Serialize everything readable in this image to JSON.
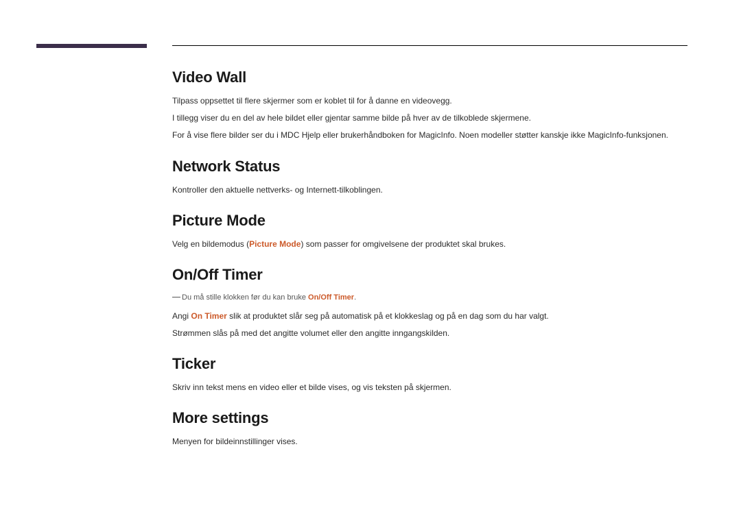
{
  "sections": {
    "video_wall": {
      "title": "Video Wall",
      "p1": "Tilpass oppsettet til flere skjermer som er koblet til for å danne en videovegg.",
      "p2": "I tillegg viser du en del av hele bildet eller gjentar samme bilde på hver av de tilkoblede skjermene.",
      "p3": "For å vise flere bilder ser du i MDC Hjelp eller brukerhåndboken for MagicInfo. Noen modeller støtter kanskje ikke MagicInfo-funksjonen."
    },
    "network_status": {
      "title": "Network Status",
      "p1": "Kontroller den aktuelle nettverks- og Internett-tilkoblingen."
    },
    "picture_mode": {
      "title": "Picture Mode",
      "p1_a": "Velg en bildemodus (",
      "p1_hl": "Picture Mode",
      "p1_b": ") som passer for omgivelsene der produktet skal brukes."
    },
    "on_off_timer": {
      "title": "On/Off Timer",
      "note_a": "Du må stille klokken før du kan bruke ",
      "note_hl": "On/Off Timer",
      "note_b": ".",
      "p1_a": "Angi ",
      "p1_hl": "On Timer",
      "p1_b": " slik at produktet slår seg på automatisk på et klokkeslag og på en dag som du har valgt.",
      "p2": "Strømmen slås på med det angitte volumet eller den angitte inngangskilden."
    },
    "ticker": {
      "title": "Ticker",
      "p1": "Skriv inn tekst mens en video eller et bilde vises, og vis teksten på skjermen."
    },
    "more_settings": {
      "title": "More settings",
      "p1": "Menyen for bildeinnstillinger vises."
    }
  }
}
